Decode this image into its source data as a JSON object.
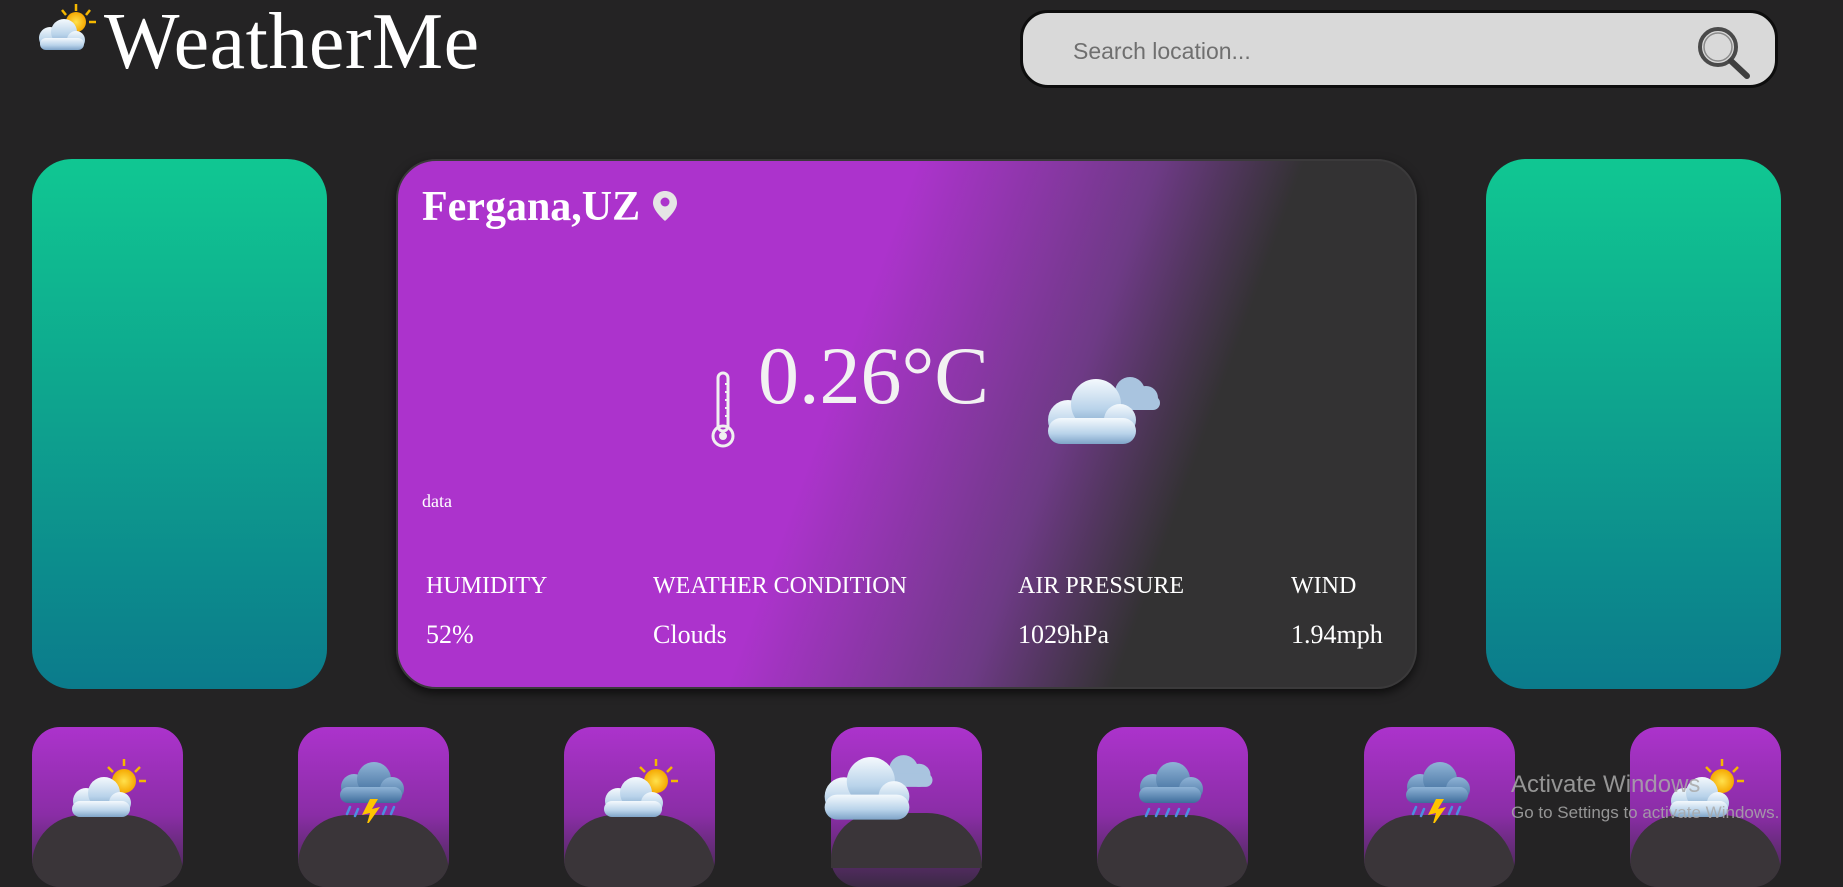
{
  "app": {
    "title": "WeatherMe"
  },
  "search": {
    "placeholder": "Search location..."
  },
  "current": {
    "location": "Fergana,UZ",
    "temperature": "0.26°C",
    "description": "data",
    "metrics": [
      {
        "label": "HUMIDITY",
        "value": "52%"
      },
      {
        "label": "WEATHER CONDITION",
        "value": "Clouds"
      },
      {
        "label": "AIR PRESSURE",
        "value": "1029hPa"
      },
      {
        "label": "WIND",
        "value": "1.94mph"
      }
    ],
    "icon": "clouds-icon"
  },
  "forecast": [
    {
      "icon": "sun-behind-cloud-icon"
    },
    {
      "icon": "thunderstorm-icon"
    },
    {
      "icon": "sun-behind-cloud-icon"
    },
    {
      "icon": "clouds-icon"
    },
    {
      "icon": "rain-cloud-icon"
    },
    {
      "icon": "thunderstorm-icon"
    },
    {
      "icon": "sun-behind-cloud-icon"
    }
  ],
  "watermark": {
    "title": "Activate Windows",
    "subtitle": "Go to Settings to activate Windows."
  },
  "colors": {
    "background": "#242324",
    "accent_purple": "#ac33cc",
    "card_dark": "#333233",
    "side_card_top": "#10c792",
    "side_card_bottom": "#0b7b8c",
    "search_bg": "#d9d9d9"
  }
}
